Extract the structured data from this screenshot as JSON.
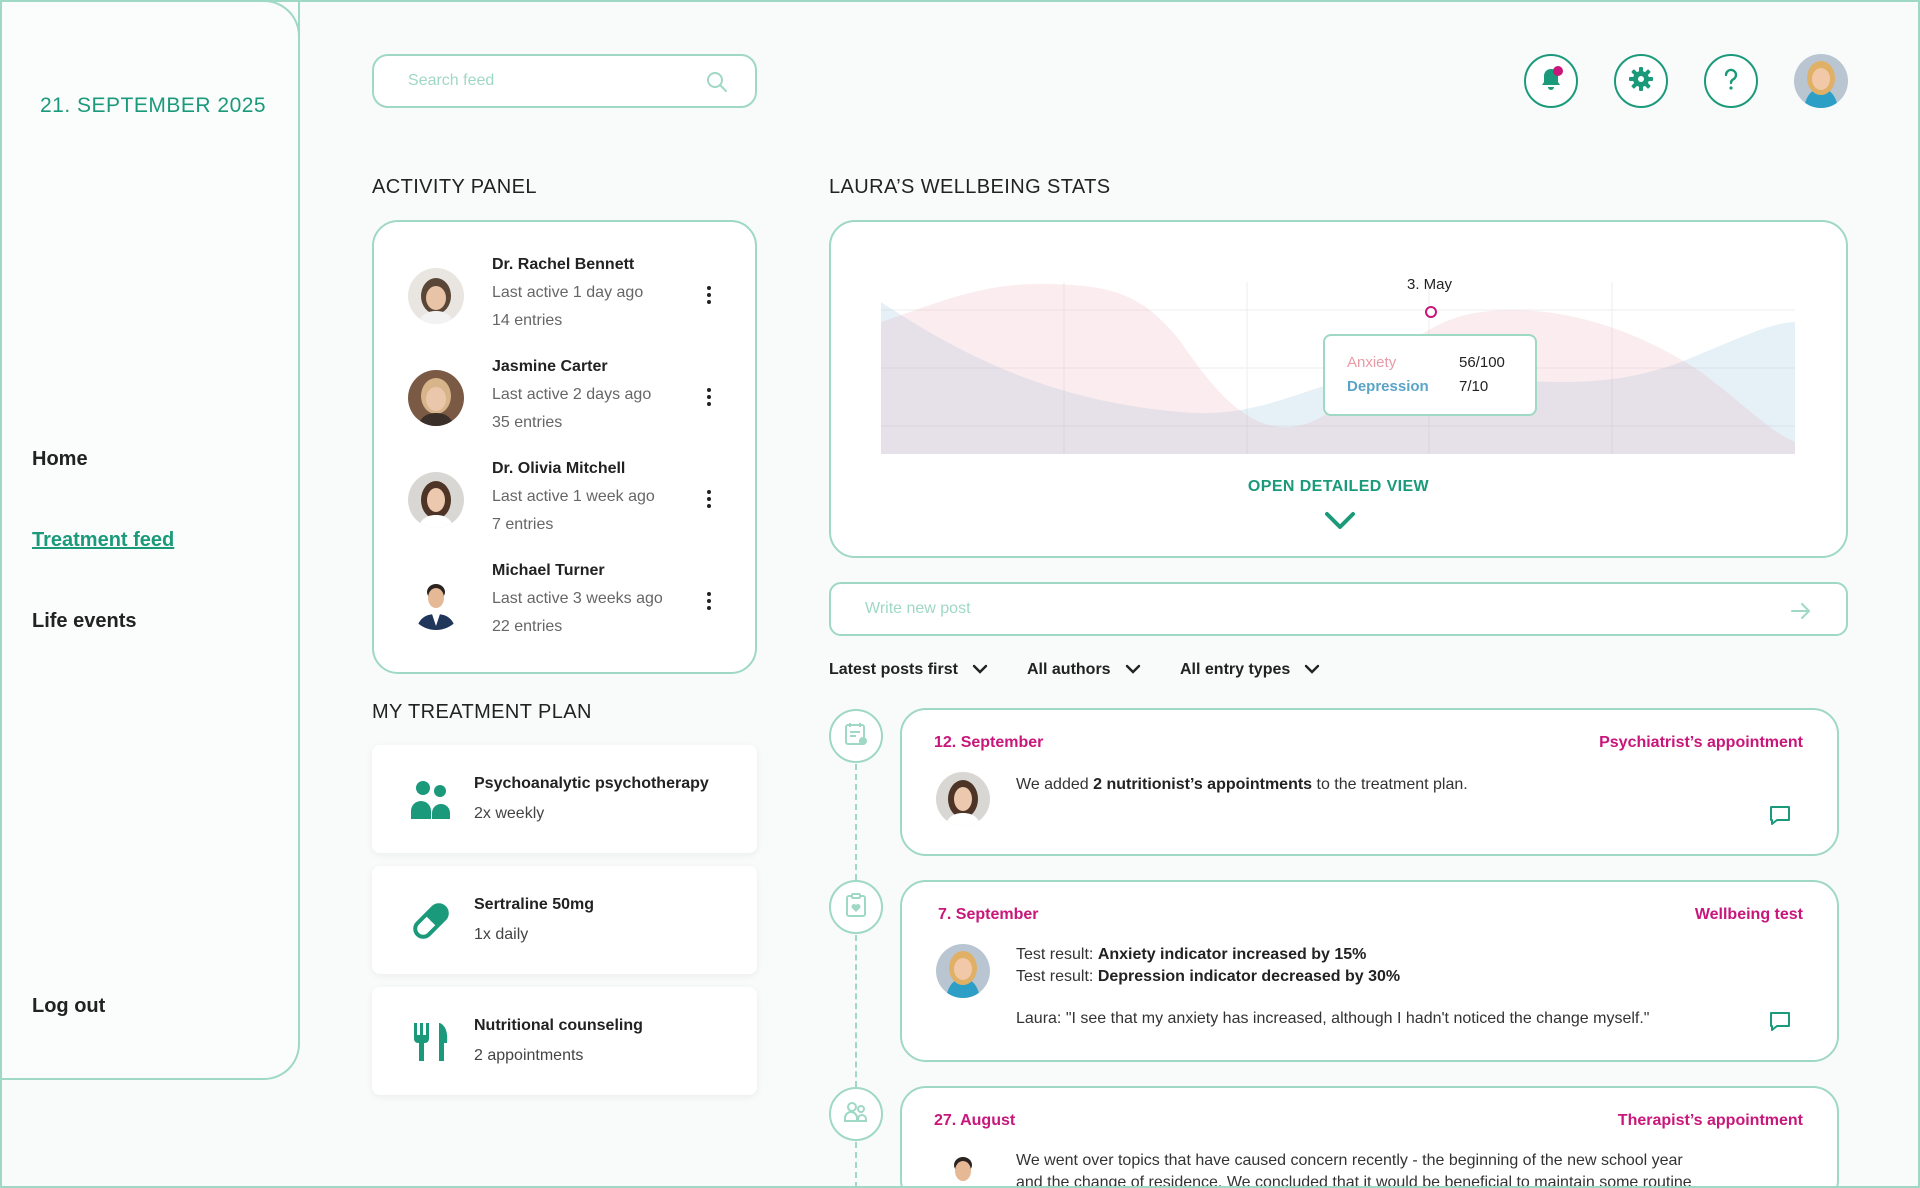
{
  "sidebar": {
    "date": "21. SEPTEMBER 2025",
    "nav": [
      "Home",
      "Treatment feed",
      "Life events"
    ],
    "logout": "Log out"
  },
  "search": {
    "placeholder": "Search feed"
  },
  "activity": {
    "title": "ACTIVITY PANEL",
    "items": [
      {
        "name": "Dr. Rachel Bennett",
        "active": "Last active 1 day ago",
        "entries": "14 entries"
      },
      {
        "name": "Jasmine Carter",
        "active": "Last active 2 days ago",
        "entries": "35 entries"
      },
      {
        "name": "Dr. Olivia Mitchell",
        "active": "Last active 1 week ago",
        "entries": "7 entries"
      },
      {
        "name": "Michael Turner",
        "active": "Last active 3 weeks ago",
        "entries": "22 entries"
      }
    ]
  },
  "plan": {
    "title": "MY TREATMENT PLAN",
    "items": [
      {
        "title": "Psychoanalytic psychotherapy",
        "sub": "2x weekly",
        "icon": "people-icon"
      },
      {
        "title": "Sertraline 50mg",
        "sub": "1x daily",
        "icon": "pill-icon"
      },
      {
        "title": "Nutritional counseling",
        "sub": "2 appointments",
        "icon": "cutlery-icon"
      }
    ]
  },
  "stats": {
    "title": "LAURA’S WELLBEING STATS",
    "tooltip_date": "3. May",
    "anxiety_label": "Anxiety",
    "anxiety_value": "56/100",
    "depression_label": "Depression",
    "depression_value": "7/10",
    "open_view": "OPEN DETAILED VIEW",
    "colors": {
      "anxiety": "#e89aa6",
      "depression": "#5aa4c8"
    }
  },
  "post": {
    "placeholder": "Write new post"
  },
  "filters": [
    "Latest posts first",
    "All authors",
    "All entry types"
  ],
  "feed": [
    {
      "date": "12. September",
      "type": "Psychiatrist’s appointment",
      "pre": "We added ",
      "bold": "2 nutritionist’s appointments",
      "post": " to the treatment plan."
    },
    {
      "date": "7. September",
      "type": "Wellbeing test",
      "line1_pre": "Test result: ",
      "line1_bold": "Anxiety indicator increased by 15%",
      "line2_pre": "Test result: ",
      "line2_bold": "Depression indicator decreased by 30%",
      "quote": "Laura: \"I see that my anxiety has increased, although I hadn't noticed the change myself.\""
    },
    {
      "date": "27. August",
      "type": "Therapist’s appointment",
      "text1": "We went over topics that have caused concern recently - the beginning of the new school year",
      "text2": "and the change of residence. We concluded that it would be beneficial to maintain some routine"
    }
  ],
  "accent": "#1a9a7a",
  "highlight": "#c8167a"
}
